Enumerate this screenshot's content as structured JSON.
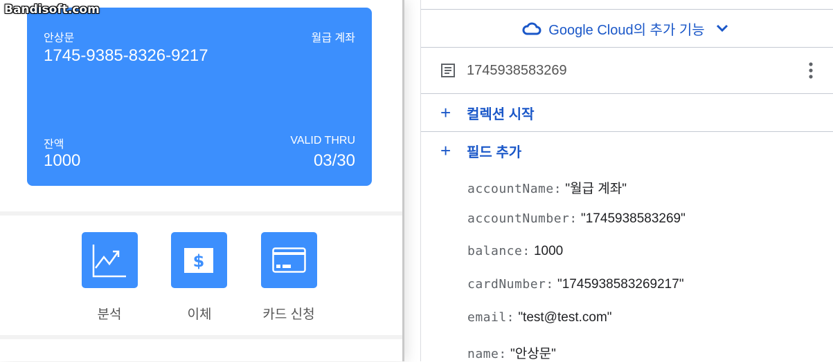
{
  "watermark": "Bandisoft.com",
  "card": {
    "holder": "안상문",
    "number": "1745-9385-8326-9217",
    "account_name": "월급 계좌",
    "balance_label": "잔액",
    "balance": "1000",
    "valid_label": "VALID THRU",
    "valid": "03/30",
    "color": "#3c8ffd"
  },
  "actions": [
    {
      "label": "분석",
      "icon": "chart-icon"
    },
    {
      "label": "이체",
      "icon": "dollar-icon"
    },
    {
      "label": "카드 신청",
      "icon": "credit-card-icon"
    }
  ],
  "firestore": {
    "gc_label": "Google Cloud의 추가 기능",
    "doc_id": "1745938583269",
    "start_collection": "컬렉션 시작",
    "add_field": "필드 추가",
    "fields": [
      {
        "key": "accountName:",
        "value": "\"월급 계좌\""
      },
      {
        "key": "accountNumber:",
        "value": "\"1745938583269\""
      },
      {
        "key": "balance:",
        "value": "1000"
      },
      {
        "key": "cardNumber:",
        "value": "\"1745938583269217\""
      },
      {
        "key": "email:",
        "value": "\"test@test.com\""
      },
      {
        "key": "name:",
        "value": "\"안상문\""
      }
    ]
  }
}
